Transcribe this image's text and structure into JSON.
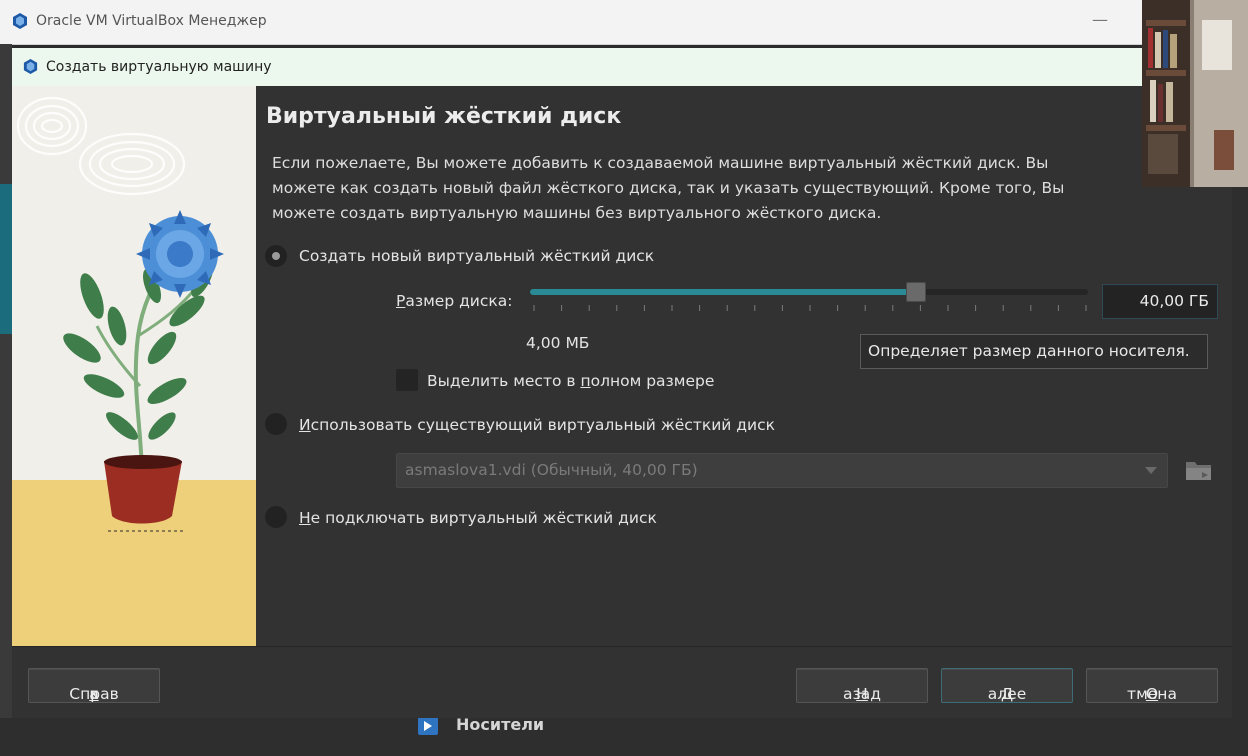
{
  "manager": {
    "title": "Oracle VM VirtualBox Менеджер",
    "minimize_glyph": "—",
    "media_label": "Носители"
  },
  "dialog": {
    "title": "Создать виртуальную машину",
    "heading": "Виртуальный жёсткий диск",
    "description": "Если пожелаете, Вы можете добавить к создаваемой машине виртуальный жёсткий диск. Вы можете как создать новый файл жёсткого диска, так и указать существующий. Кроме того, Вы можете создать виртуальную машины без виртуального жёсткого диска.",
    "options": {
      "create_new": {
        "label": "Создать новый виртуальный жёсткий диск",
        "selected": true
      },
      "use_existing": {
        "label_mnemonic": "И",
        "label_rest": "спользовать существующий виртуальный жёсткий диск",
        "selected": false
      },
      "none": {
        "label_mnemonic": "Н",
        "label_rest": "е подключать виртуальный жёсткий диск",
        "selected": false
      }
    },
    "disk_size": {
      "label_mnemonic": "Р",
      "label_rest": "азмер диска:",
      "min_label": "4,00 МБ",
      "value": "40,00 ГБ",
      "slider_fraction": 0.69,
      "tooltip": "Определяет размер данного носителя."
    },
    "preallocate": {
      "label_before": "Выделить место в ",
      "label_mnemonic": "п",
      "label_after": "олном размере",
      "checked": false
    },
    "existing_disk": {
      "value": "asmaslova1.vdi (Обычный, 40,00 ГБ)"
    },
    "buttons": {
      "help_before": "Справ",
      "help_mnemonic": "к",
      "help_after": "а",
      "back_mnemonic": "Н",
      "back_rest": "азад",
      "next_mnemonic": "Д",
      "next_rest": "алее",
      "cancel_mnemonic": "О",
      "cancel_rest": "тмена"
    }
  },
  "colors": {
    "dialog_bg": "#323232",
    "accent": "#2a8a95",
    "titlebar_bg": "#ecf8ee"
  }
}
